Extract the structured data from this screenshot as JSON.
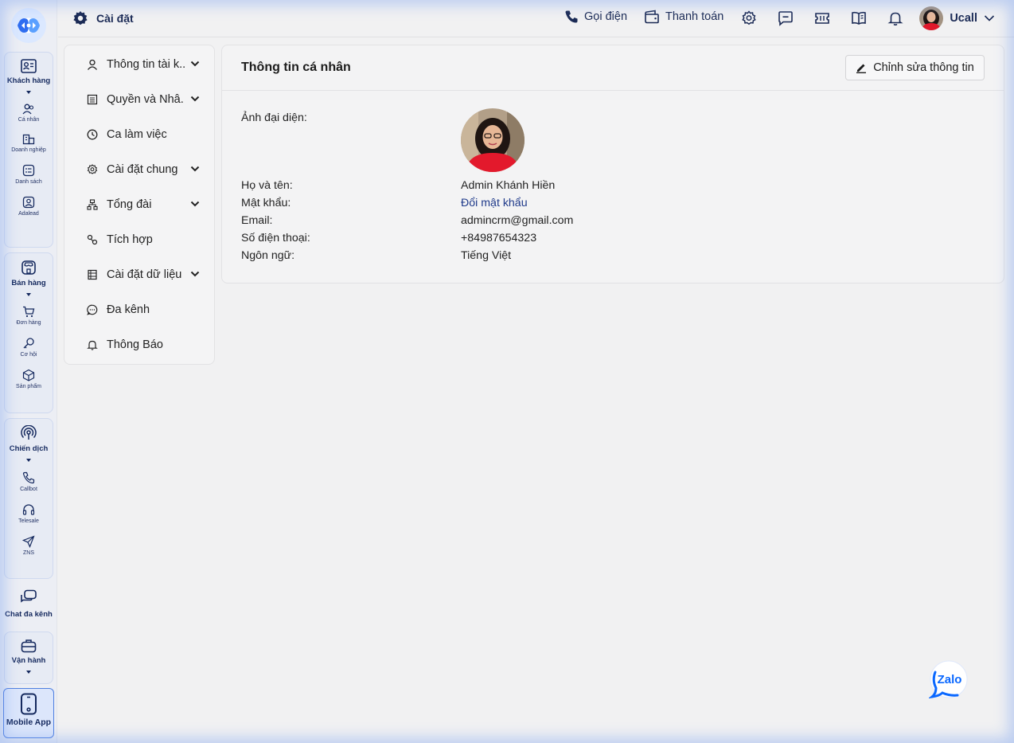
{
  "rail": {
    "groups": [
      {
        "label": "Khách hàng",
        "items": [
          "Cá nhân",
          "Doanh nghiệp",
          "Danh sách",
          "Adalead"
        ]
      },
      {
        "label": "Bán hàng",
        "items": [
          "Đơn hàng",
          "Cơ hội",
          "Sản phẩm"
        ]
      },
      {
        "label": "Chiến dịch",
        "items": [
          "Callbot",
          "Telesale",
          "ZNS"
        ]
      }
    ],
    "chat": "Chat đa kênh",
    "operations": "Vận hành",
    "mobile_app": "Mobile App"
  },
  "topbar": {
    "title": "Cài đặt",
    "call": "Gọi điện",
    "payment": "Thanh toán",
    "user_name": "Ucall"
  },
  "menu": {
    "items": [
      {
        "label": "Thông tin tài k...",
        "icon": "user-icon",
        "has_chevron": true
      },
      {
        "label": "Quyền và Nhâ...",
        "icon": "list-icon",
        "has_chevron": true
      },
      {
        "label": "Ca làm việc",
        "icon": "clock-icon",
        "has_chevron": false
      },
      {
        "label": "Cài đặt chung",
        "icon": "gear-icon",
        "has_chevron": true
      },
      {
        "label": "Tổng đài",
        "icon": "network-icon",
        "has_chevron": true
      },
      {
        "label": "Tích hợp",
        "icon": "link-icon",
        "has_chevron": false
      },
      {
        "label": "Cài đặt dữ liệu",
        "icon": "database-icon",
        "has_chevron": true
      },
      {
        "label": "Đa kênh",
        "icon": "chat-icon",
        "has_chevron": false
      },
      {
        "label": "Thông Báo",
        "icon": "bell-icon",
        "has_chevron": false
      }
    ]
  },
  "profile": {
    "title": "Thông tin cá nhân",
    "edit_button": "Chỉnh sửa thông tin",
    "avatar_label": "Ảnh đại diện:",
    "fields": [
      {
        "label": "Họ và tên:",
        "value": "Admin Khánh Hiền"
      },
      {
        "label": "Mật khẩu:",
        "value": "Đổi mật khẩu"
      },
      {
        "label": "Email:",
        "value": "admincrm@gmail.com"
      },
      {
        "label": "Số điện thoại:",
        "value": "+84987654323"
      },
      {
        "label": "Ngôn ngữ:",
        "value": "Tiếng Việt"
      }
    ]
  },
  "zalo": {
    "label": "Zalo"
  },
  "colors": {
    "accent": "#1b2a55",
    "link": "#1f3a8a",
    "rail_border": "#cfd9ef",
    "zalo_blue": "#0a68ff"
  }
}
